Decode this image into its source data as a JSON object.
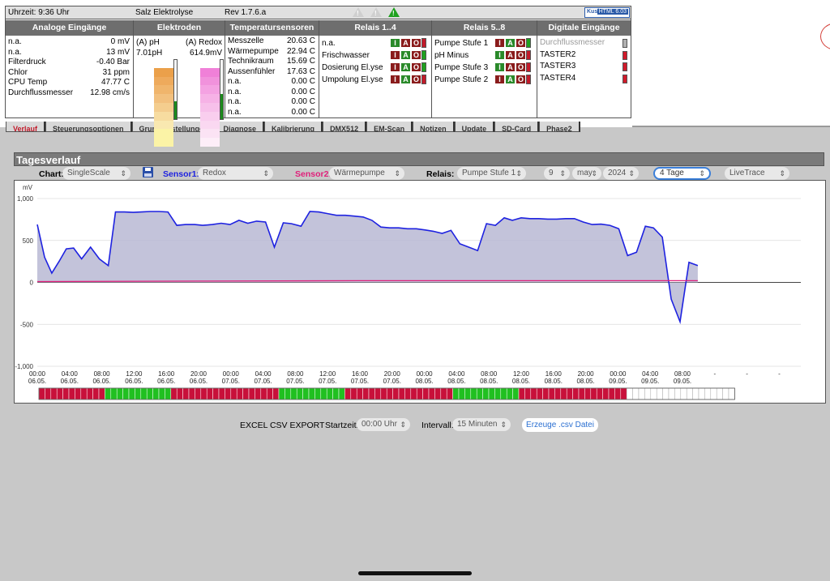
{
  "header": {
    "time": "Uhrzeit: 9:36 Uhr",
    "device": "Salz Elektrolyse",
    "revision": "Rev 1.7.6.a",
    "logo_left": "Kusim",
    "logo_right": "HTML 6.03"
  },
  "analog": {
    "title": "Analoge Eingänge",
    "rows": [
      {
        "label": "n.a.",
        "value": "0 mV"
      },
      {
        "label": "n.a.",
        "value": "13 mV"
      },
      {
        "label": "Filterdruck",
        "value": "-0.40 Bar"
      },
      {
        "label": "Chlor",
        "value": "31 ppm"
      },
      {
        "label": "CPU Temp",
        "value": "47.77 C"
      },
      {
        "label": "Durchflussmesser",
        "value": "12.98 cm/s"
      }
    ]
  },
  "electrodes": {
    "title": "Elektroden",
    "ph_label": "(A) pH",
    "ph_value": "7.01pH",
    "redox_label": "(A) Redox",
    "redox_value": "614.9mV",
    "ph_level": 0.3,
    "redox_level": 0.42
  },
  "temperature": {
    "title": "Temperatursensoren",
    "rows": [
      {
        "label": "Messzelle",
        "value": "20.63 C"
      },
      {
        "label": "Wärmepumpe",
        "value": "22.94 C"
      },
      {
        "label": "Technikraum",
        "value": "15.69 C"
      },
      {
        "label": "Aussenfühler",
        "value": "17.63 C"
      },
      {
        "label": "n.a.",
        "value": "0.00 C"
      },
      {
        "label": "n.a.",
        "value": "0.00 C"
      },
      {
        "label": "n.a.",
        "value": "0.00 C"
      },
      {
        "label": "n.a.",
        "value": "0.00 C"
      }
    ]
  },
  "relais14": {
    "title": "Relais 1..4",
    "rows": [
      {
        "label": "n.a.",
        "mode": "I",
        "led": "red"
      },
      {
        "label": "Frischwasser",
        "mode": "A",
        "led": "green"
      },
      {
        "label": "Dosierung El.yse",
        "mode": "A",
        "led": "green"
      },
      {
        "label": "Umpolung El.yse",
        "mode": "A",
        "led": "red"
      }
    ]
  },
  "relais58": {
    "title": "Relais 5..8",
    "rows": [
      {
        "label": "Pumpe Stufe 1",
        "mode": "A",
        "led": "green"
      },
      {
        "label": "pH Minus",
        "mode": "I",
        "led": "red"
      },
      {
        "label": "Pumpe Stufe 3",
        "mode": "I",
        "led": "red"
      },
      {
        "label": "Pumpe Stufe 2",
        "mode": "A",
        "led": "red"
      }
    ]
  },
  "digital": {
    "title": "Digitale Eingänge",
    "rows": [
      {
        "label": "Durchflussmesser",
        "led": "grey",
        "disabled": true
      },
      {
        "label": "TASTER2",
        "led": "red",
        "disabled": false
      },
      {
        "label": "TASTER3",
        "led": "red",
        "disabled": false
      },
      {
        "label": "TASTER4",
        "led": "red",
        "disabled": false
      }
    ]
  },
  "iao_letters": [
    "I",
    "A",
    "O"
  ],
  "tabs": [
    {
      "label": "Verlauf",
      "active": true
    },
    {
      "label": "Steuerungsoptionen",
      "active": false
    },
    {
      "label": "Grundeinstellungen",
      "active": false
    },
    {
      "label": "Diagnose",
      "active": false
    },
    {
      "label": "Kalibrierung",
      "active": false
    },
    {
      "label": "DMX512",
      "active": false
    },
    {
      "label": "EM-Scan",
      "active": false
    },
    {
      "label": "Notizen",
      "active": false
    },
    {
      "label": "Update",
      "active": false
    },
    {
      "label": "SD-Card",
      "active": false
    },
    {
      "label": "Phase2",
      "active": false
    }
  ],
  "tagesverlauf": {
    "title": "Tagesverlauf",
    "chart_label": "Chart:",
    "chart_select": "SingleScale",
    "sensor1_label": "Sensor1:",
    "sensor1_select": "Redox",
    "sensor1_color": "#1e22e0",
    "sensor2_label": "Sensor2:",
    "sensor2_select": "Wärmepumpe",
    "sensor2_color": "#e0207a",
    "relais_label": "Relais:",
    "relais_select": "Pumpe Stufe 1",
    "day_select": "9",
    "month_select": "may",
    "year_select": "2024",
    "range_select": "4 Tage",
    "mode_select": "LiveTrace"
  },
  "chart_data": {
    "type": "line",
    "ylabel": "mV",
    "ylim": [
      -1000,
      1000
    ],
    "yticks": [
      1000,
      500,
      0,
      -500,
      -1000
    ],
    "ytick_labels": [
      "1,000",
      "500",
      "0",
      "-500",
      "-1,000"
    ],
    "grid": true,
    "xtick_labels": [
      [
        "00:00",
        "06.05."
      ],
      [
        "04:00",
        "06.05."
      ],
      [
        "08:00",
        "06.05."
      ],
      [
        "12:00",
        "06.05."
      ],
      [
        "16:00",
        "06.05."
      ],
      [
        "20:00",
        "06.05."
      ],
      [
        "00:00",
        "07.05."
      ],
      [
        "04:00",
        "07.05."
      ],
      [
        "08:00",
        "07.05."
      ],
      [
        "12:00",
        "07.05."
      ],
      [
        "16:00",
        "07.05."
      ],
      [
        "20:00",
        "07.05."
      ],
      [
        "00:00",
        "08.05."
      ],
      [
        "04:00",
        "08.05."
      ],
      [
        "08:00",
        "08.05."
      ],
      [
        "12:00",
        "08.05."
      ],
      [
        "16:00",
        "08.05."
      ],
      [
        "20:00",
        "08.05."
      ],
      [
        "00:00",
        "09.05."
      ],
      [
        "04:00",
        "09.05."
      ],
      [
        "08:00",
        "09.05."
      ],
      [
        "-",
        ""
      ],
      [
        "-",
        ""
      ],
      [
        "-",
        ""
      ]
    ],
    "x_hours_total": 92,
    "series": [
      {
        "name": "Redox",
        "color": "#1e22e0",
        "fill": true,
        "points": [
          [
            0,
            690
          ],
          [
            0.9,
            300
          ],
          [
            1.8,
            110
          ],
          [
            2.7,
            250
          ],
          [
            3.6,
            400
          ],
          [
            4.5,
            410
          ],
          [
            5.5,
            280
          ],
          [
            6.6,
            420
          ],
          [
            7.7,
            280
          ],
          [
            8.8,
            200
          ],
          [
            9.7,
            840
          ],
          [
            10.8,
            840
          ],
          [
            11.9,
            835
          ],
          [
            12.9,
            840
          ],
          [
            14.0,
            845
          ],
          [
            15.1,
            845
          ],
          [
            16.2,
            840
          ],
          [
            17.3,
            680
          ],
          [
            18.4,
            690
          ],
          [
            19.5,
            690
          ],
          [
            20.5,
            680
          ],
          [
            21.7,
            690
          ],
          [
            22.8,
            705
          ],
          [
            23.9,
            690
          ],
          [
            25.0,
            740
          ],
          [
            26.1,
            705
          ],
          [
            27.2,
            730
          ],
          [
            28.3,
            720
          ],
          [
            29.4,
            420
          ],
          [
            30.5,
            710
          ],
          [
            31.5,
            700
          ],
          [
            32.7,
            670
          ],
          [
            33.8,
            845
          ],
          [
            34.9,
            840
          ],
          [
            36.0,
            820
          ],
          [
            37.1,
            800
          ],
          [
            38.2,
            800
          ],
          [
            39.3,
            790
          ],
          [
            40.4,
            780
          ],
          [
            41.5,
            740
          ],
          [
            42.6,
            660
          ],
          [
            43.7,
            650
          ],
          [
            44.8,
            650
          ],
          [
            45.9,
            640
          ],
          [
            47.0,
            640
          ],
          [
            48.1,
            625
          ],
          [
            49.1,
            610
          ],
          [
            50.2,
            585
          ],
          [
            51.3,
            620
          ],
          [
            52.4,
            460
          ],
          [
            53.5,
            420
          ],
          [
            54.6,
            380
          ],
          [
            55.7,
            700
          ],
          [
            56.8,
            680
          ],
          [
            57.9,
            770
          ],
          [
            58.9,
            740
          ],
          [
            60.0,
            770
          ],
          [
            61.1,
            760
          ],
          [
            62.2,
            760
          ],
          [
            63.3,
            755
          ],
          [
            64.4,
            755
          ],
          [
            65.5,
            760
          ],
          [
            66.6,
            760
          ],
          [
            67.7,
            720
          ],
          [
            68.8,
            690
          ],
          [
            69.9,
            695
          ],
          [
            71.0,
            680
          ],
          [
            72.1,
            640
          ],
          [
            73.2,
            320
          ],
          [
            74.3,
            360
          ],
          [
            75.4,
            670
          ],
          [
            76.4,
            650
          ],
          [
            77.5,
            540
          ],
          [
            78.6,
            -200
          ],
          [
            79.7,
            -470
          ],
          [
            80.8,
            240
          ],
          [
            81.9,
            200
          ]
        ]
      },
      {
        "name": "Wärmepumpe",
        "color": "#e0207a",
        "fill": false,
        "points": [
          [
            0,
            10
          ],
          [
            20,
            15
          ],
          [
            40,
            20
          ],
          [
            60,
            20
          ],
          [
            81.9,
            20
          ]
        ]
      }
    ],
    "relay_blocks": [
      {
        "state": "off",
        "count": 11
      },
      {
        "state": "on",
        "count": 11
      },
      {
        "state": "off",
        "count": 18
      },
      {
        "state": "on",
        "count": 11
      },
      {
        "state": "off",
        "count": 18
      },
      {
        "state": "on",
        "count": 11
      },
      {
        "state": "off",
        "count": 18
      },
      {
        "state": "none",
        "count": 18
      }
    ],
    "relay_colors": {
      "on": "#20c020",
      "off": "#c8103a",
      "none": "#ffffff"
    }
  },
  "export": {
    "title": "EXCEL CSV EXPORT",
    "start_label": "Startzeit:",
    "start_select": "00:00 Uhr",
    "interval_label": "Intervall:",
    "interval_select": "15 Minuten",
    "button": "Erzeuge .csv Datei"
  }
}
